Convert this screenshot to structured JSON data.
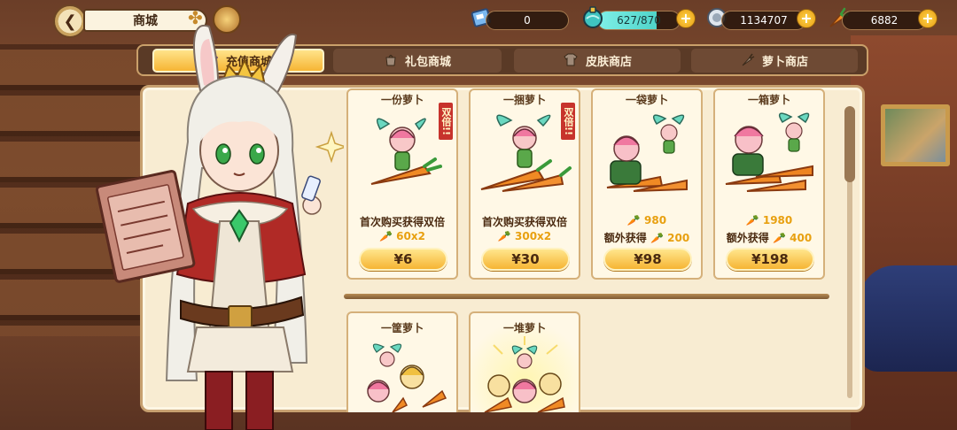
{
  "header": {
    "title": "商城",
    "back_icon": "back-arrow-icon"
  },
  "resources": {
    "tickets": {
      "value": "0",
      "icon": "ticket-icon"
    },
    "energy": {
      "value": "627/870",
      "icon": "energy-potion-icon",
      "fill_fraction": 0.72
    },
    "coins": {
      "value": "1134707",
      "icon": "coin-icon"
    },
    "carrots": {
      "value": "6882",
      "icon": "carrot-icon"
    },
    "plus_label": "+"
  },
  "tabs": [
    {
      "label": "充值商城",
      "icon": "crystal-icon",
      "active": true
    },
    {
      "label": "礼包商城",
      "icon": "gift-bag-icon",
      "active": false
    },
    {
      "label": "皮肤商店",
      "icon": "skin-icon",
      "active": false
    },
    {
      "label": "萝卜商店",
      "icon": "carrot-icon",
      "active": false
    }
  ],
  "products": [
    {
      "title": "一份萝卜",
      "badge": "双倍!!",
      "line1_prefix": "首次购买获得双倍",
      "line2_amount": "60x2",
      "price": "¥6"
    },
    {
      "title": "一捆萝卜",
      "badge": "双倍!!",
      "line1_prefix": "首次购买获得双倍",
      "line2_amount": "300x2",
      "price": "¥30"
    },
    {
      "title": "一袋萝卜",
      "amount": "980",
      "bonus_label": "额外获得",
      "bonus": "200",
      "price": "¥98"
    },
    {
      "title": "一箱萝卜",
      "amount": "1980",
      "bonus_label": "额外获得",
      "bonus": "400",
      "price": "¥198"
    },
    {
      "title": "一筐萝卜"
    },
    {
      "title": "一堆萝卜"
    }
  ],
  "colors": {
    "accent": "#f6b534",
    "badge": "#c7332c",
    "panel": "#f8ecd2",
    "energy": "#4fd4c8"
  }
}
